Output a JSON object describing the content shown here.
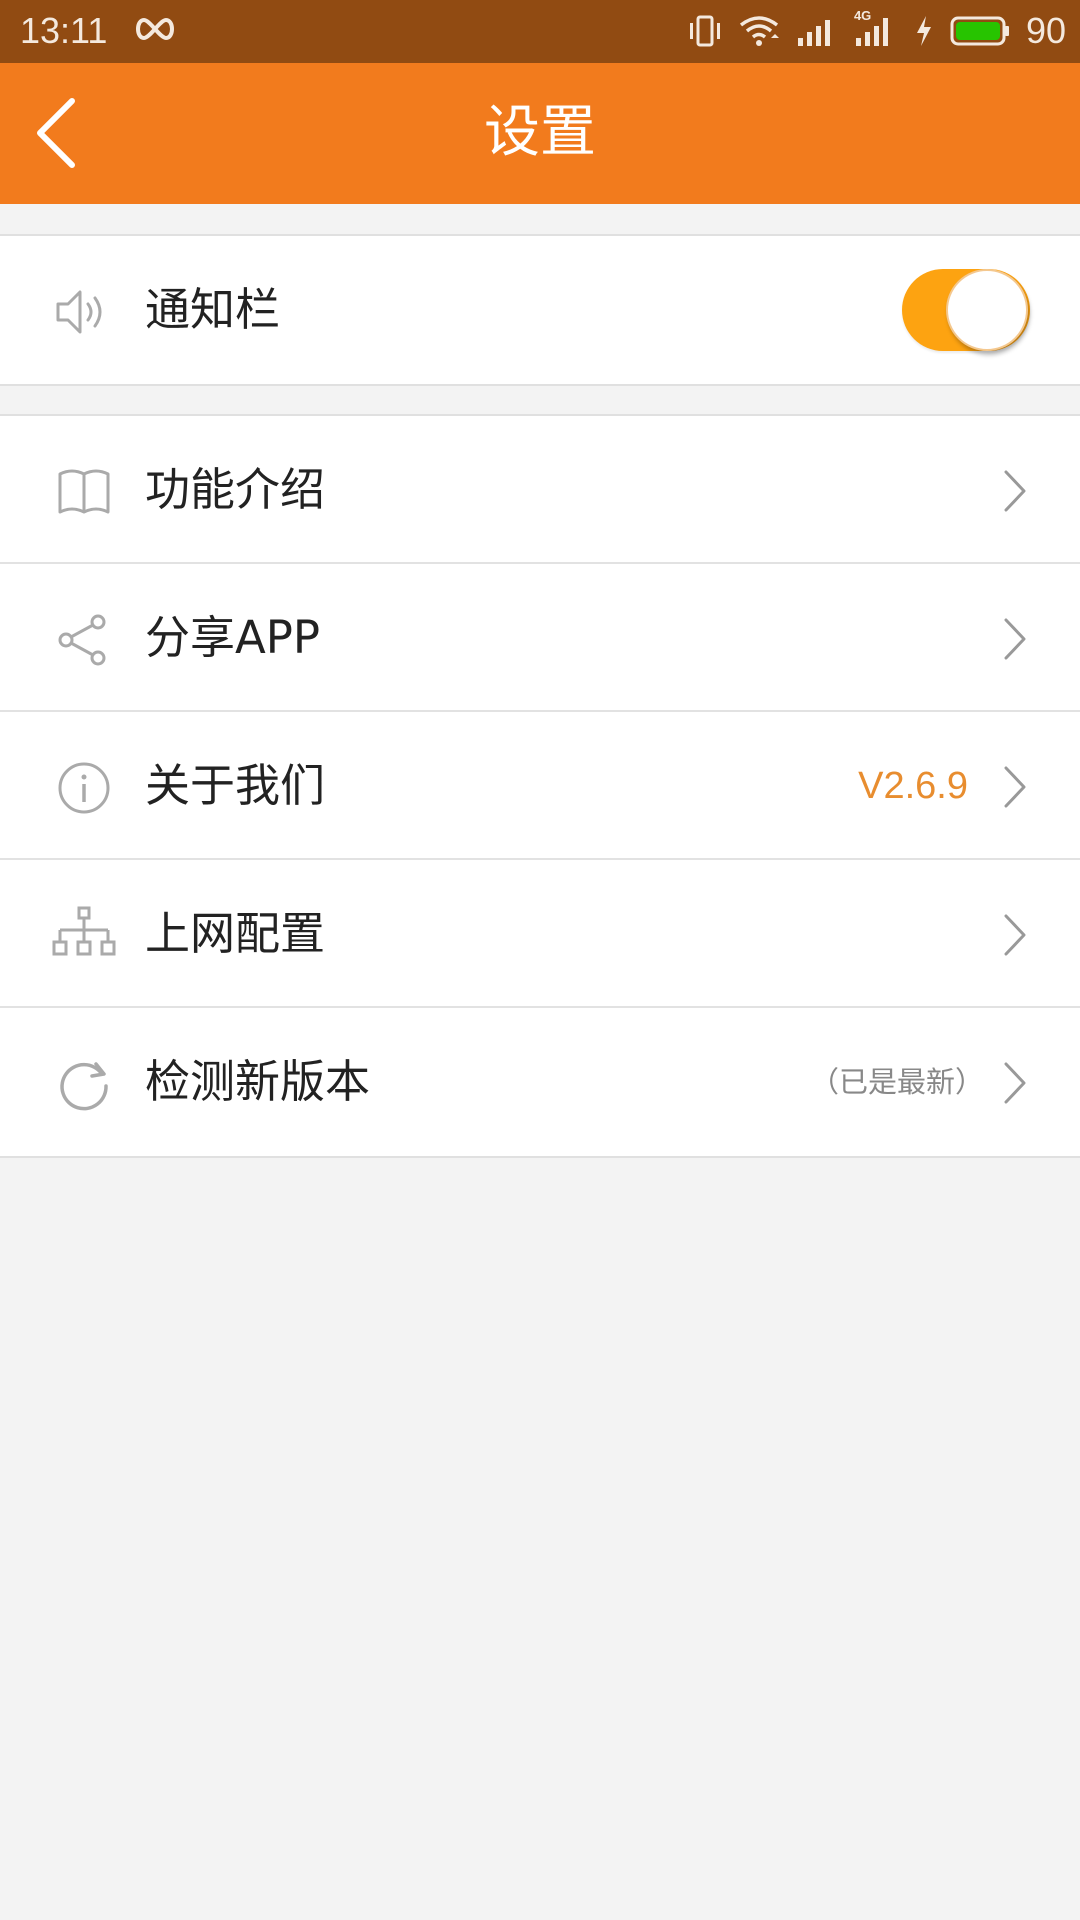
{
  "status_bar": {
    "time": "13:11",
    "battery_level": "90",
    "battery_color": "#27c400",
    "icons": [
      "infinity-icon",
      "vibrate-icon",
      "wifi-icon",
      "signal-icon",
      "4g-signal-icon",
      "charging-icon",
      "battery-icon"
    ],
    "network_label": "4G"
  },
  "header": {
    "title": "设置",
    "background": "#f27b1d",
    "back_icon": "chevron-left-icon"
  },
  "settings": {
    "notification": {
      "label": "通知栏",
      "icon": "speaker-icon",
      "toggle_on": true,
      "toggle_color": "#fda311"
    },
    "items": [
      {
        "label": "功能介绍",
        "icon": "book-icon"
      },
      {
        "label": "分享APP",
        "icon": "share-icon"
      },
      {
        "label": "关于我们",
        "icon": "info-icon",
        "value": "V2.6.9",
        "value_color": "#e88d2f"
      },
      {
        "label": "上网配置",
        "icon": "network-icon"
      },
      {
        "label": "检测新版本",
        "icon": "refresh-icon",
        "note": "（已是最新）"
      }
    ]
  }
}
